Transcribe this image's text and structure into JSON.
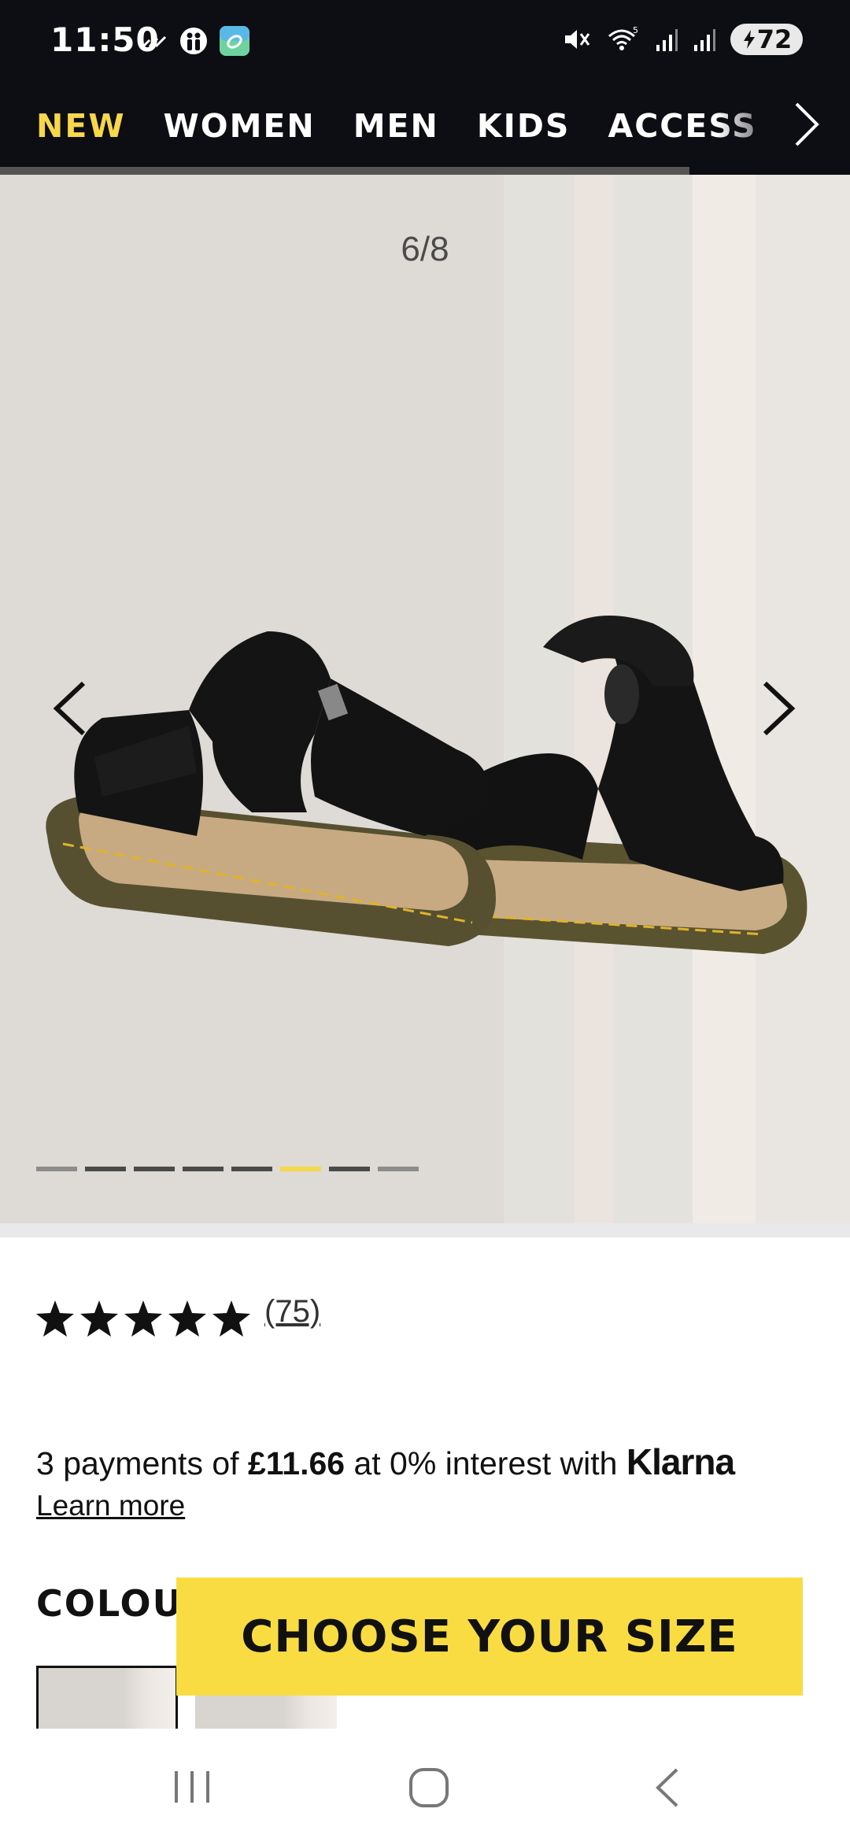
{
  "status_bar": {
    "time": "11:50",
    "battery": "72",
    "icons": [
      "wifi-calling-icon",
      "family-app-icon",
      "green-app-icon",
      "mute-icon",
      "wifi-icon",
      "signal-icon",
      "signal-icon-2"
    ]
  },
  "nav": {
    "items": [
      {
        "label": "NEW",
        "active": true
      },
      {
        "label": "WOMEN",
        "active": false
      },
      {
        "label": "MEN",
        "active": false
      },
      {
        "label": "KIDS",
        "active": false
      },
      {
        "label": "ACCESS",
        "active": false
      }
    ],
    "more_icon": "chevron-right-icon"
  },
  "gallery": {
    "counter": "6/8",
    "current": 6,
    "total": 8,
    "prev_icon": "chevron-left-icon",
    "next_icon": "chevron-right-icon",
    "image": "kids black leather sandals with yellow stitching"
  },
  "product": {
    "rating": 5,
    "review_count": "(75)",
    "klarna": {
      "prefix": "3 payments of ",
      "amount": "£11.66",
      "suffix": " at 0% interest with ",
      "brand": "Klarna"
    },
    "learn_more": "Learn more",
    "colour_label": "COLOU"
  },
  "cta": {
    "label": "CHOOSE YOUR SIZE"
  },
  "colors": {
    "accent": "#f9dc42",
    "nav_bg": "#0d0d14",
    "gallery_bg": "#dedad6"
  }
}
